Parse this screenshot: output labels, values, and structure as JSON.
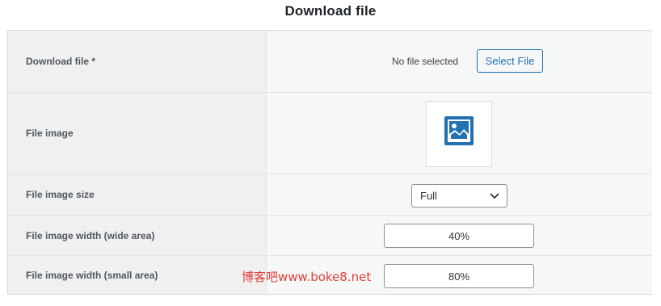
{
  "title": "Download file",
  "rows": {
    "download_file": {
      "label": "Download file *",
      "status_text": "No file selected",
      "button_label": "Select File"
    },
    "file_image": {
      "label": "File image",
      "icon": "image-placeholder-icon"
    },
    "file_image_size": {
      "label": "File image size",
      "selected": "Full"
    },
    "file_image_width_wide": {
      "label": "File image width (wide area)",
      "value": "40%"
    },
    "file_image_width_small": {
      "label": "File image width (small area)",
      "value": "80%"
    }
  },
  "watermark": "博客吧www.boke8.net",
  "colors": {
    "accent": "#2271b1",
    "watermark": "#e0403a",
    "label_bg": "#f0f0f1",
    "value_bg": "#f6f7f7"
  }
}
